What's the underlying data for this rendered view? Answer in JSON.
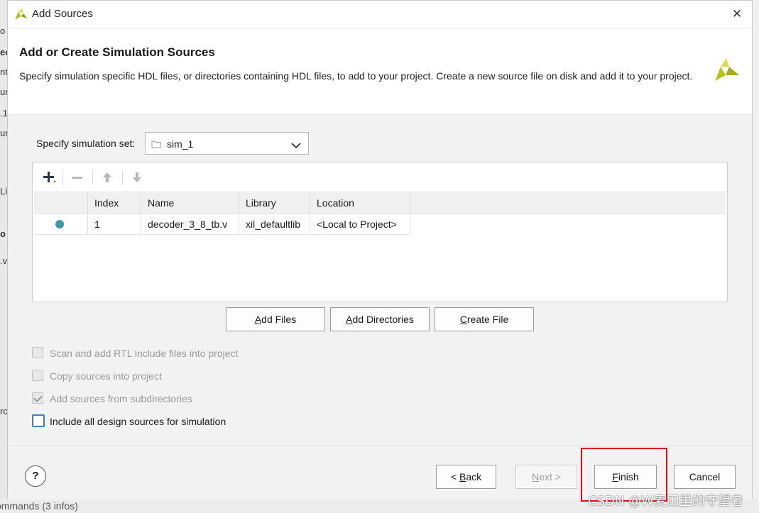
{
  "background": {
    "fragments": [
      "o",
      "ec",
      "nt",
      "un",
      ".1",
      "ur",
      "Li",
      "o",
      ".v",
      "ro"
    ],
    "bottom_text": "ommands (3 infos)"
  },
  "window": {
    "title": "Add Sources",
    "close_glyph": "✕"
  },
  "header": {
    "title": "Add or Create Simulation Sources",
    "description": "Specify simulation specific HDL files, or directories containing HDL files, to add to your project. Create a new source file on disk and add it to your project."
  },
  "simulation_set": {
    "label": "Specify simulation set:",
    "value": "sim_1"
  },
  "toolbar": {
    "icons": [
      "plus-icon",
      "minus-icon",
      "arrow-up-icon",
      "arrow-down-icon"
    ]
  },
  "table": {
    "columns": [
      "",
      "Index",
      "Name",
      "Library",
      "Location"
    ],
    "rows": [
      {
        "status": "dot",
        "index": "1",
        "name": "decoder_3_8_tb.v",
        "library": "xil_defaultlib",
        "location": "<Local to Project>"
      }
    ]
  },
  "action_buttons": {
    "add_files": "Add Files",
    "add_directories": "Add Directories",
    "create_file": "Create File"
  },
  "options": [
    {
      "label": "Scan and add RTL include files into project",
      "checked": false,
      "enabled": false
    },
    {
      "label": "Copy sources into project",
      "checked": false,
      "enabled": false
    },
    {
      "label": "Add sources from subdirectories",
      "checked": true,
      "enabled": false
    },
    {
      "label": "Include all design sources for simulation",
      "checked": false,
      "enabled": true
    }
  ],
  "footer": {
    "help": "?",
    "back": "< Back",
    "next": "Next >",
    "finish": "Finish",
    "cancel": "Cancel"
  },
  "watermark": "CSDN @W麦田里的守望者",
  "colors": {
    "accent": "#3c7fc6",
    "status_dot": "#3a9aa8",
    "highlight": "#e0101a",
    "logo": "#b6c224"
  }
}
